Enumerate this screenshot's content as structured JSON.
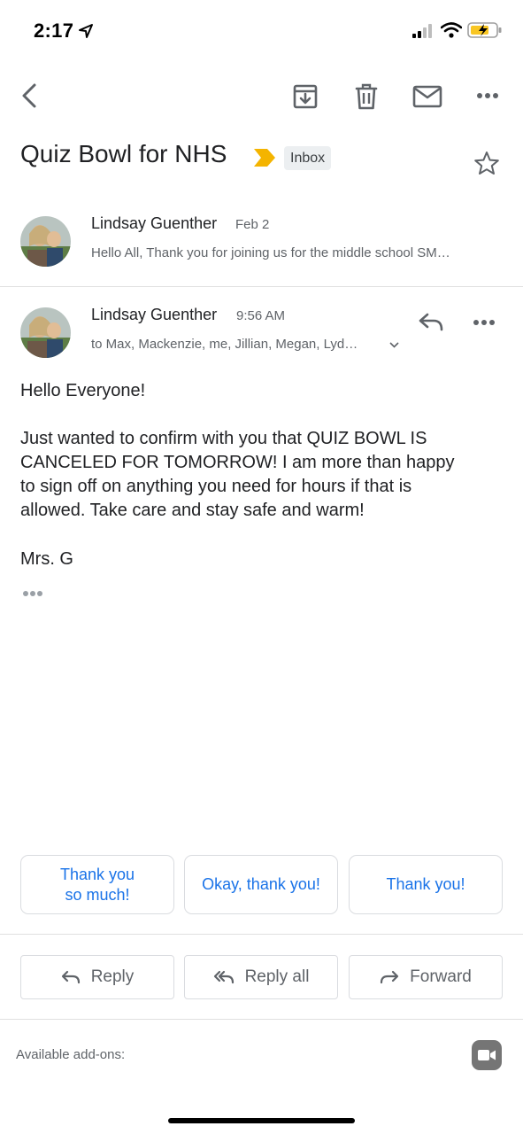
{
  "status_bar": {
    "time": "2:17"
  },
  "toolbar": {
    "icons": [
      "back-icon",
      "archive-icon",
      "delete-icon",
      "mark-unread-icon",
      "more-icon"
    ]
  },
  "thread": {
    "subject": "Quiz Bowl for NHS",
    "label": "Inbox",
    "starred": false
  },
  "messages": [
    {
      "sender": "Lindsay Guenther",
      "date": "Feb 2",
      "snippet": "Hello All, Thank you for joining us for the middle school SM…"
    },
    {
      "sender": "Lindsay Guenther",
      "time": "9:56 AM",
      "recipients": "to Max, Mackenzie, me, Jillian, Megan, Lyd…",
      "greeting": "Hello Everyone!",
      "paragraph_lines": [
        "Just wanted to confirm with you that QUIZ BOWL IS",
        "CANCELED FOR TOMORROW! I am more than happy",
        "to sign off on anything you need for hours if that is",
        "allowed. Take care and stay safe and warm!"
      ],
      "signoff": "Mrs. G"
    }
  ],
  "smart_replies": [
    {
      "line1": "Thank you",
      "line2": "so much!"
    },
    {
      "line1": "Okay, thank you!",
      "line2": ""
    },
    {
      "line1": "Thank you!",
      "line2": ""
    }
  ],
  "actions": {
    "reply": "Reply",
    "reply_all": "Reply all",
    "forward": "Forward"
  },
  "addons": {
    "label": "Available add-ons:"
  },
  "colors": {
    "accent": "#1a73e8",
    "importance": "#f4b400",
    "chip_bg": "#eceff1"
  }
}
